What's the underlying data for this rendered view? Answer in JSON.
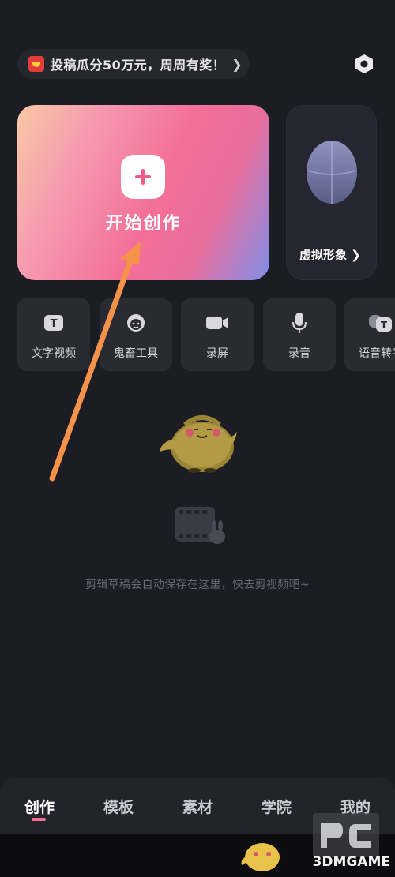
{
  "banner": {
    "text": "投稿瓜分50万元，周周有奖！",
    "arrow": "❯"
  },
  "create": {
    "label": "开始创作"
  },
  "avatar": {
    "label": "虚拟形象 ❯"
  },
  "tools": [
    {
      "label": "文字视频",
      "icon": "text-video-icon"
    },
    {
      "label": "鬼畜工具",
      "icon": "monkey-face-icon"
    },
    {
      "label": "录屏",
      "icon": "camera-icon"
    },
    {
      "label": "录音",
      "icon": "microphone-icon"
    },
    {
      "label": "语音转字",
      "icon": "speech-to-text-icon"
    }
  ],
  "empty": {
    "text": "剪辑草稿会自动保存在这里，快去剪视频吧~"
  },
  "tabs": [
    {
      "label": "创作",
      "active": true
    },
    {
      "label": "模板",
      "active": false
    },
    {
      "label": "素材",
      "active": false
    },
    {
      "label": "学院",
      "active": false
    },
    {
      "label": "我的",
      "active": false
    }
  ],
  "watermark": {
    "text": "3DMGAME"
  },
  "colors": {
    "accent": "#f46b8c",
    "background": "#1c1c24",
    "annotation_arrow": "#f4924a"
  }
}
